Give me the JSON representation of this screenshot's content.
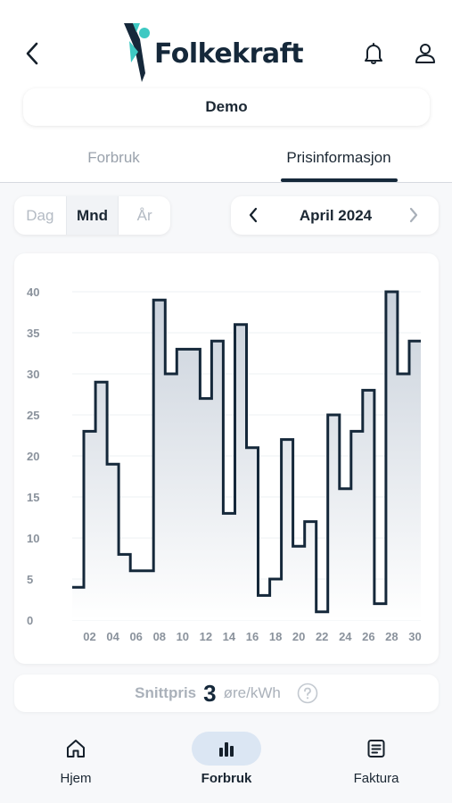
{
  "header": {
    "logo_text": "Folkekraft",
    "account_name": "Demo"
  },
  "tabs": [
    {
      "label": "Forbruk",
      "active": false
    },
    {
      "label": "Prisinformasjon",
      "active": true
    }
  ],
  "period_selector": {
    "options": [
      "Dag",
      "Mnd",
      "År"
    ],
    "selected": "Mnd"
  },
  "date_picker": {
    "label": "April 2024"
  },
  "chart_data": {
    "type": "step",
    "unit": "øre/kWh",
    "x": [
      1,
      2,
      3,
      4,
      5,
      6,
      7,
      8,
      9,
      10,
      11,
      12,
      13,
      14,
      15,
      16,
      17,
      18,
      19,
      20,
      21,
      22,
      23,
      24,
      25,
      26,
      27,
      28,
      29,
      30
    ],
    "values": [
      4,
      23,
      29,
      19,
      8,
      6,
      6,
      39,
      30,
      33,
      33,
      27,
      34,
      13,
      36,
      21,
      3,
      5,
      22,
      9,
      12,
      1,
      25,
      16,
      23,
      28,
      2,
      40,
      30,
      34
    ],
    "x_tick_labels": [
      "02",
      "04",
      "06",
      "08",
      "10",
      "12",
      "14",
      "16",
      "18",
      "20",
      "22",
      "24",
      "26",
      "28",
      "30"
    ],
    "y_ticks": [
      0,
      5,
      10,
      15,
      20,
      25,
      30,
      35,
      40
    ],
    "ylim": [
      0,
      40
    ],
    "grid": true,
    "line_color": "#15283a",
    "fill_color_top": "#c9d1db",
    "fill_color_bottom": "#ffffff"
  },
  "average": {
    "label": "Snittpris",
    "value": "3",
    "unit": "øre/kWh"
  },
  "bottom_nav": [
    {
      "label": "Hjem",
      "icon": "home-icon",
      "active": false
    },
    {
      "label": "Forbruk",
      "icon": "bar-chart-icon",
      "active": true
    },
    {
      "label": "Faktura",
      "icon": "invoice-icon",
      "active": false
    }
  ],
  "colors": {
    "brand": "#15283a",
    "accent": "#3ec9c3",
    "nav_selected_bg": "#dbe6f3"
  }
}
